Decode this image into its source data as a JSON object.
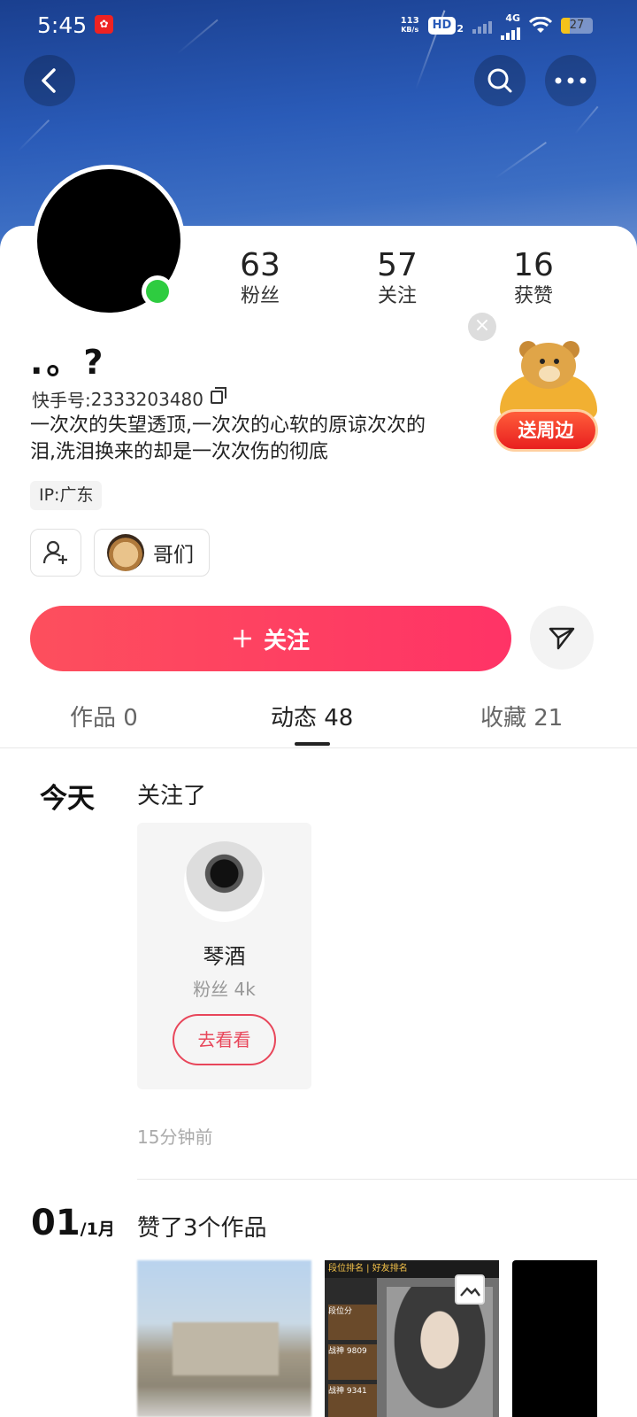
{
  "status_bar": {
    "time": "5:45",
    "net_speed_value": "113",
    "net_speed_unit": "KB/s",
    "hd_label": "HD",
    "hd_sub": "2",
    "network": "4G",
    "battery": "27"
  },
  "profile": {
    "nickname": ".。?",
    "kuaishou_id_label": "快手号:",
    "kuaishou_id": "2333203480",
    "bio_line1": "一次次的失望透顶,一次次的心软的原谅次次的",
    "bio_line2": "泪,洗泪换来的却是一次次伤的彻底",
    "ip_label": "IP:广东",
    "stats": [
      {
        "num": "63",
        "label": "粉丝"
      },
      {
        "num": "57",
        "label": "关注"
      },
      {
        "num": "16",
        "label": "获赞"
      }
    ],
    "friend_chip_label": "哥们",
    "follow_button": "关注",
    "promo_button": "送周边"
  },
  "tabs": [
    {
      "label": "作品 0",
      "active": false
    },
    {
      "label": "动态 48",
      "active": true
    },
    {
      "label": "收藏 21",
      "active": false
    }
  ],
  "feed": {
    "today_label": "今天",
    "item1_title": "关注了",
    "followed_user": {
      "name": "琴酒",
      "fans": "粉丝 4k",
      "button": "去看看"
    },
    "item1_time": "15分钟前",
    "date2_day": "01",
    "date2_month": "/1月",
    "item2_title": "赞了3个作品",
    "thumb2_header": "段位排名 | 好友排名",
    "thumb2_row1": "段位分",
    "thumb2_row2": "战神 9809",
    "thumb2_row3": "战神 9341"
  },
  "colors": {
    "accent": "#fe3666",
    "online": "#2ecc40",
    "header_blue": "#2a5bb8"
  }
}
